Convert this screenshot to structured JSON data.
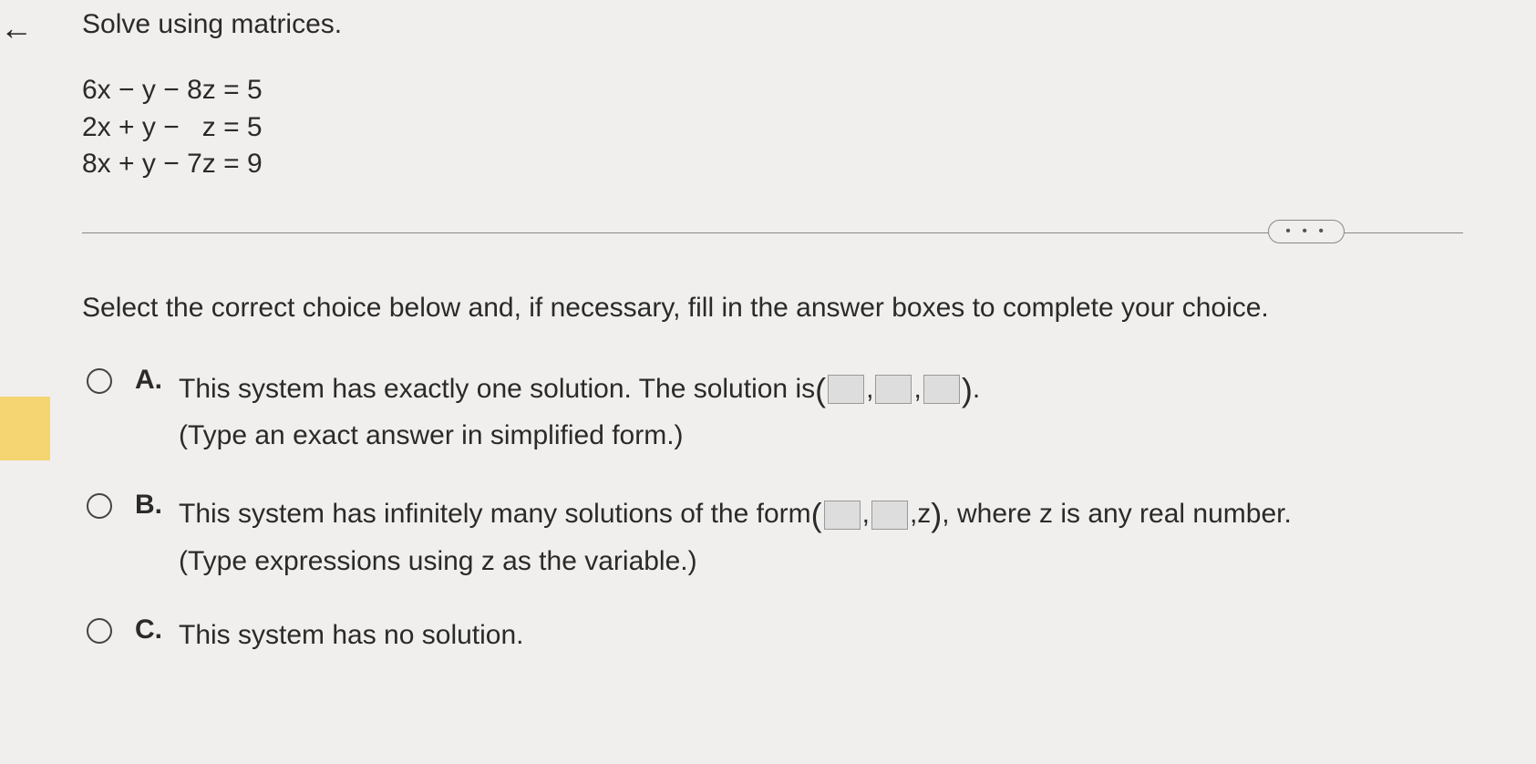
{
  "question": {
    "title": "Solve using matrices.",
    "equations": [
      "6x − y − 8z = 5",
      "2x + y −   z = 5",
      "8x + y − 7z = 9"
    ]
  },
  "more_button": "• • •",
  "instruction": "Select the correct choice below and, if necessary, fill in the answer boxes to complete your choice.",
  "choices": {
    "a": {
      "label": "A.",
      "line1_pre": "This system has exactly one solution. The solution is ",
      "paren_open": "(",
      "comma1": ",",
      "comma2": ",",
      "paren_close": ")",
      "period": " .",
      "line2": "(Type an exact answer in simplified form.)"
    },
    "b": {
      "label": "B.",
      "line1_pre": "This system has infinitely many solutions of the form ",
      "paren_open": "(",
      "comma1": ",",
      "z_part": ",z",
      "paren_close": ")",
      "post": " , where z is any real number.",
      "line2": "(Type expressions using z as the variable.)"
    },
    "c": {
      "label": "C.",
      "text": "This system has no solution."
    }
  }
}
